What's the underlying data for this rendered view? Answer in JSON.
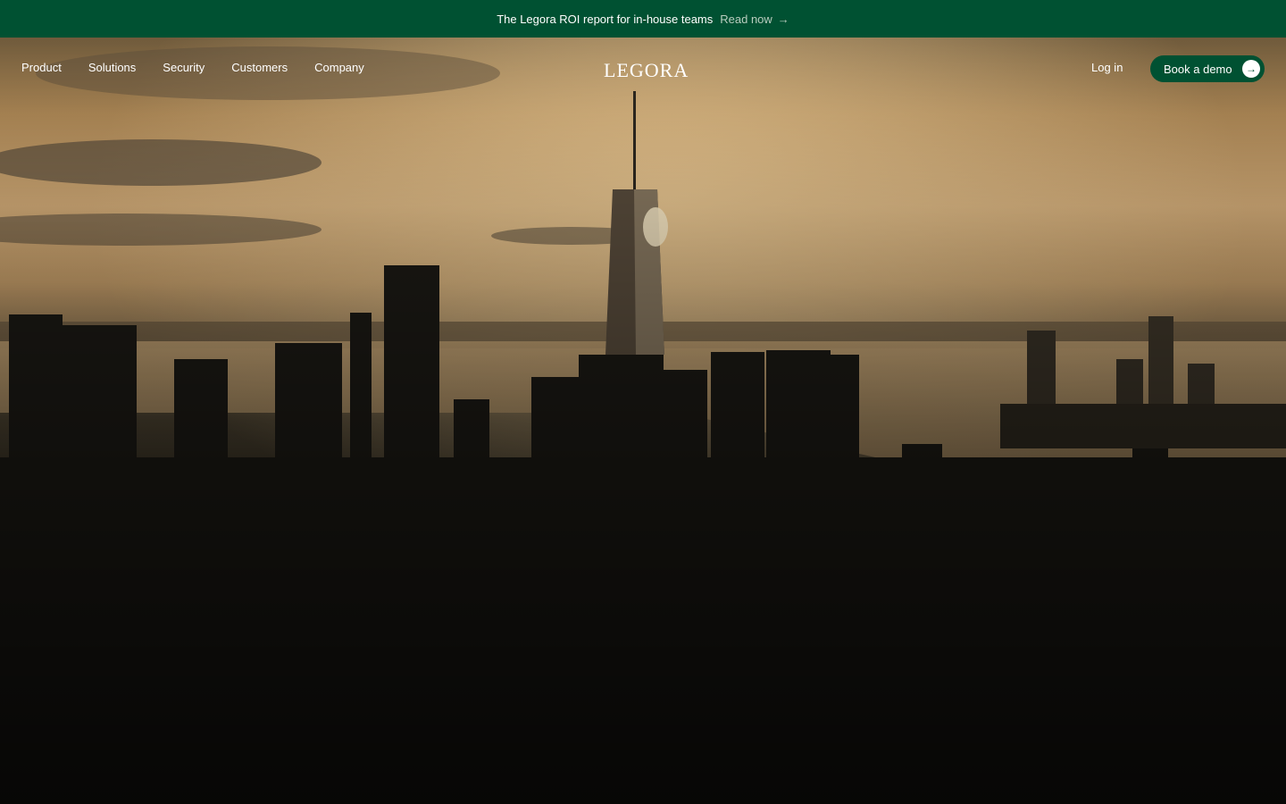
{
  "announcement": {
    "text": "The Legora ROI report for in-house teams",
    "link_label": "Read now",
    "link_icon": "→"
  },
  "nav": {
    "links": [
      "Product",
      "Solutions",
      "Security",
      "Customers",
      "Company"
    ],
    "logo": "LEGORA",
    "login_label": "Log in",
    "cta_label": "Book a demo",
    "cta_icon": "→"
  },
  "colors": {
    "brand_green": "#005132",
    "muted_link": "#b9cdbf"
  },
  "hero": {
    "image_description": "aerial-city-skyline-sunset"
  }
}
